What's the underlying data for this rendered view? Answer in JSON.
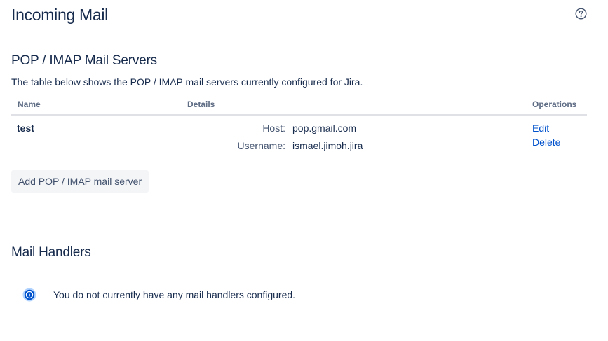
{
  "page": {
    "title": "Incoming Mail",
    "help_icon": "question-circle-icon"
  },
  "pop_imap": {
    "title": "POP / IMAP Mail Servers",
    "description": "The table below shows the POP / IMAP mail servers currently configured for Jira.",
    "columns": [
      "Name",
      "Details",
      "Operations"
    ],
    "rows": [
      {
        "name": "test",
        "details": [
          {
            "label": "Host:",
            "value": "pop.gmail.com"
          },
          {
            "label": "Username:",
            "value": "ismael.jimoh.jira"
          }
        ],
        "operations": [
          "Edit",
          "Delete"
        ]
      }
    ],
    "add_button": "Add POP / IMAP mail server"
  },
  "mail_handlers": {
    "title": "Mail Handlers",
    "info_icon": "info-circle-icon",
    "message": "You do not currently have any mail handlers configured."
  },
  "colors": {
    "text": "#172b4d",
    "muted": "#5e6c84",
    "link": "#0052cc",
    "info": "#0052cc",
    "border": "#dfe1e6",
    "button_bg": "#f4f5f7"
  }
}
